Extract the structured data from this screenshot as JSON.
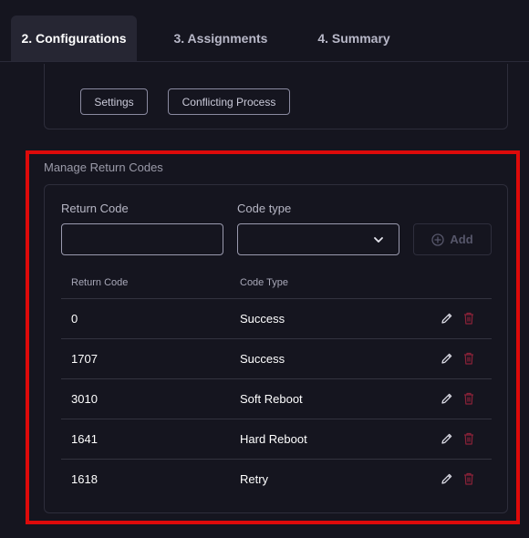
{
  "tabs": [
    {
      "label": "2. Configurations",
      "active": true
    },
    {
      "label": "3. Assignments",
      "active": false
    },
    {
      "label": "4. Summary",
      "active": false
    }
  ],
  "previous_section": {
    "buttons": [
      "Settings",
      "Conflicting Process"
    ]
  },
  "return_codes": {
    "title": "Manage Return Codes",
    "return_code_label": "Return Code",
    "return_code_value": "",
    "code_type_label": "Code type",
    "code_type_value": "",
    "add_label": "Add",
    "columns": [
      "Return Code",
      "Code Type"
    ],
    "rows": [
      {
        "code": "0",
        "type": "Success"
      },
      {
        "code": "1707",
        "type": "Success"
      },
      {
        "code": "3010",
        "type": "Soft Reboot"
      },
      {
        "code": "1641",
        "type": "Hard Reboot"
      },
      {
        "code": "1618",
        "type": "Retry"
      }
    ]
  },
  "colors": {
    "background": "#15151f",
    "highlight": "#dd0a0a",
    "delete_icon": "#8a2238",
    "active_tab": "#262633"
  },
  "icons": {
    "edit": "pencil-icon",
    "delete": "trash-icon",
    "add": "plus-circle-icon",
    "select": "chevron-down-icon"
  }
}
